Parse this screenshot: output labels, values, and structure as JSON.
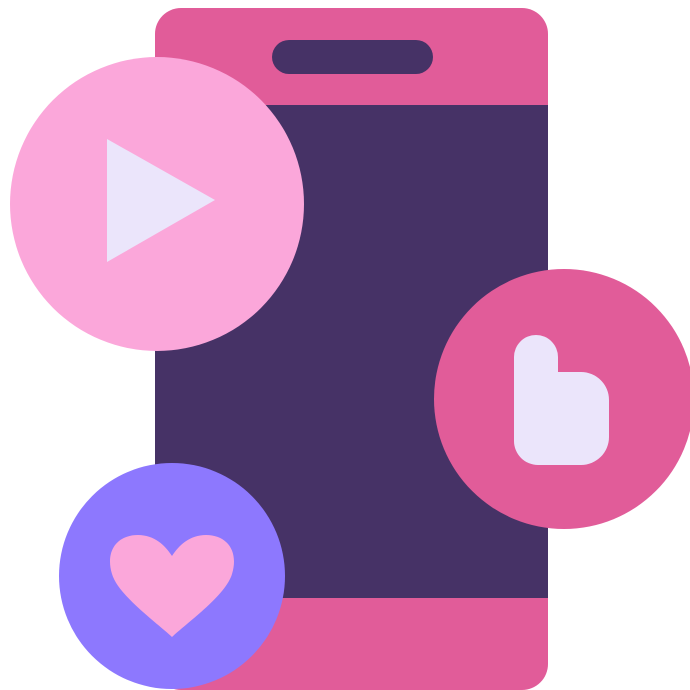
{
  "illustration": {
    "subject": "smartphone",
    "badges": [
      {
        "icon": "play-icon"
      },
      {
        "icon": "thumbs-up-icon"
      },
      {
        "icon": "heart-icon"
      }
    ]
  },
  "colors": {
    "phone_frame": "#e15c99",
    "phone_screen": "#463266",
    "speaker_slot": "#463266",
    "play_badge": "#fba7da",
    "play_icon": "#ebe5fb",
    "like_badge": "#e15c99",
    "like_icon": "#ebe5fb",
    "heart_badge": "#8d78fe",
    "heart_icon": "#fba7da"
  }
}
